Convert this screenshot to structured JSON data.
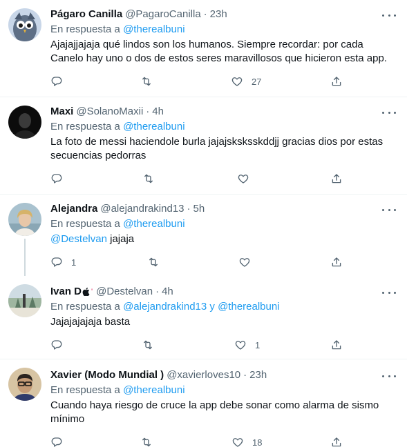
{
  "colors": {
    "accent": "#1d9bf0",
    "secondary_text": "#536471",
    "primary_text": "#0f1419",
    "divider": "#eff3f4"
  },
  "reply_prefix": "En respuesta a",
  "tweets": [
    {
      "name": "Págaro Canilla",
      "handle": "@PagaroCanilla",
      "time": "23h",
      "reply_to_1": "@therealbuni",
      "text": "Ajajajjajaja qué lindos son los humanos. Siempre recordar: por cada Canelo hay uno o dos de estos seres maravillosos que hicieron esta app.",
      "replies": "",
      "retweets": "",
      "likes": "27"
    },
    {
      "name": "Maxi",
      "handle": "@SolanoMaxii",
      "time": "4h",
      "reply_to_1": "@therealbuni",
      "text": "La foto de messi haciendole burla jajajsksksskddjj gracias dios por estas secuencias pedorras",
      "replies": "",
      "retweets": "",
      "likes": ""
    },
    {
      "name": "Alejandra",
      "handle": "@alejandrakind13",
      "time": "5h",
      "reply_to_1": "@therealbuni",
      "text_mention": "@Destelvan",
      "text": " jajaja",
      "replies": "1",
      "retweets": "",
      "likes": ""
    },
    {
      "name": "Ivan D",
      "handle": "@Destelvan",
      "time": "4h",
      "reply_to_1": "@alejandrakind13",
      "reply_joiner": "y",
      "reply_to_2": "@therealbuni",
      "text": "Jajajajajaja basta",
      "replies": "",
      "retweets": "",
      "likes": "1"
    },
    {
      "name": "Xavier (Modo Mundial )",
      "handle": "@xavierloves10",
      "time": "23h",
      "reply_to_1": "@therealbuni",
      "text": "Cuando haya riesgo de cruce la app debe sonar como alarma de sismo mínimo",
      "replies": "",
      "retweets": "",
      "likes": "18"
    }
  ],
  "icons": {
    "reply": "reply-icon",
    "retweet": "retweet-icon",
    "like": "heart-icon",
    "share": "share-icon",
    "more": "more-icon"
  }
}
